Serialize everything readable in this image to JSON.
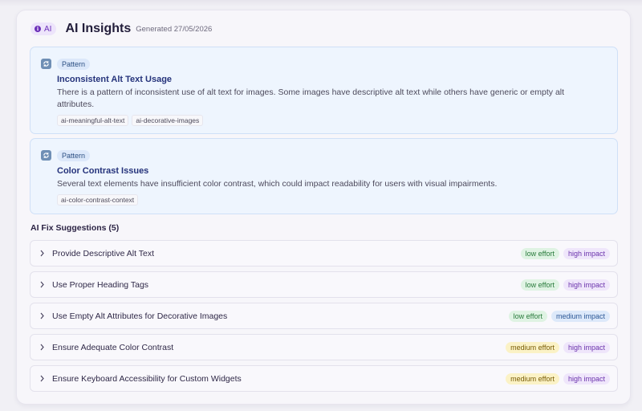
{
  "header": {
    "ai_badge": "AI",
    "title": "AI Insights",
    "generated": "Generated 27/05/2026"
  },
  "insights": [
    {
      "type": "Pattern",
      "title": "Inconsistent Alt Text Usage",
      "description": "There is a pattern of inconsistent use of alt text for images. Some images have descriptive alt text while others have generic or empty alt attributes.",
      "tags": [
        "ai-meaningful-alt-text",
        "ai-decorative-images"
      ]
    },
    {
      "type": "Pattern",
      "title": "Color Contrast Issues",
      "description": "Several text elements have insufficient color contrast, which could impact readability for users with visual impairments.",
      "tags": [
        "ai-color-contrast-context"
      ]
    }
  ],
  "fixes": {
    "heading": "AI Fix Suggestions (5)",
    "items": [
      {
        "label": "Provide Descriptive Alt Text",
        "effort": "low effort",
        "impact": "high impact"
      },
      {
        "label": "Use Proper Heading Tags",
        "effort": "low effort",
        "impact": "high impact"
      },
      {
        "label": "Use Empty Alt Attributes for Decorative Images",
        "effort": "low effort",
        "impact": "medium impact"
      },
      {
        "label": "Ensure Adequate Color Contrast",
        "effort": "medium effort",
        "impact": "high impact"
      },
      {
        "label": "Ensure Keyboard Accessibility for Custom Widgets",
        "effort": "medium effort",
        "impact": "high impact"
      }
    ]
  },
  "colors": {
    "accent_purple": "#6b2fb8",
    "insight_bg": "#eef5fe",
    "low_effort": "#dff3e3",
    "medium_effort": "#fbf2c6",
    "high_impact": "#efe6fb",
    "medium_impact": "#dde9fa"
  }
}
